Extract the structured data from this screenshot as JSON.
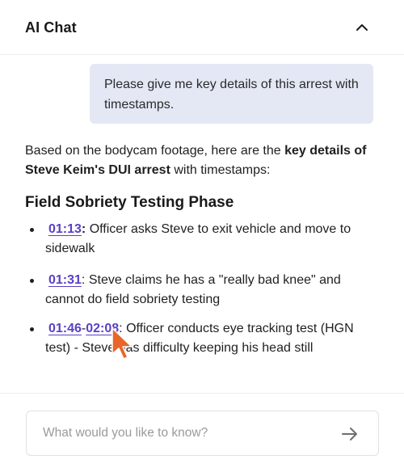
{
  "header": {
    "title": "AI Chat",
    "collapse_icon": "chevron-up-icon"
  },
  "user_message": {
    "text": "Please give me key details of this arrest with timestamps."
  },
  "assistant_reply": {
    "intro_prefix": "Based on the bodycam footage, here are the ",
    "intro_bold": "key details of Steve Keim's DUI arrest",
    "intro_suffix": " with timestamps:",
    "section_heading": "Field Sobriety Testing Phase",
    "items": [
      {
        "timestamp": "01:13",
        "separator": ":",
        "text": " Officer asks Steve to exit vehicle and move to sidewalk"
      },
      {
        "timestamp": "01:31",
        "separator": ":",
        "text": " Steve claims he has a \"really bad knee\" and cannot do field sobriety testing"
      },
      {
        "timestamp_start": "01:46",
        "range_dash": "-",
        "timestamp_end": "02:08",
        "separator": ":",
        "text": " Officer conducts eye tracking test (HGN test) - Steve has difficulty keeping his head still"
      }
    ]
  },
  "composer": {
    "placeholder": "What would you like to know?",
    "value": "",
    "send_icon": "arrow-right-icon"
  },
  "colors": {
    "accent": "#5b3fc4",
    "user_bubble": "#e4e8f5",
    "cursor": "#e8662a"
  }
}
